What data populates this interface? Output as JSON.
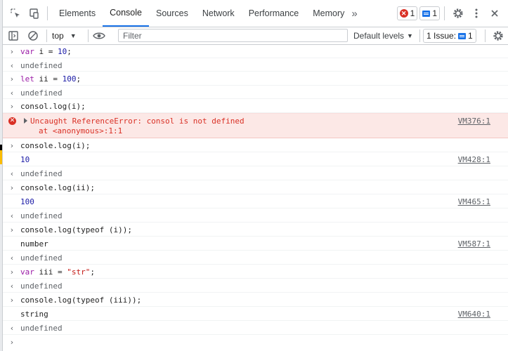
{
  "tabs": [
    {
      "label": "Elements"
    },
    {
      "label": "Console"
    },
    {
      "label": "Sources"
    },
    {
      "label": "Network"
    },
    {
      "label": "Performance"
    },
    {
      "label": "Memory"
    }
  ],
  "badges": {
    "errors": "1",
    "messages": "1"
  },
  "toolbar": {
    "context": "top",
    "filter_placeholder": "Filter",
    "levels": "Default levels",
    "issues": "1 Issue:",
    "issues_count": "1"
  },
  "console": {
    "r1": "var i = 10;",
    "undefined": "undefined",
    "r3": "let ii = 100;",
    "r5": "consol.log(i);",
    "err1": "Uncaught ReferenceError: consol is not defined",
    "err2": "at <anonymous>:1:1",
    "err_src": "VM376:1",
    "r7": "console.log(i);",
    "o8": "10",
    "s8": "VM428:1",
    "r10": "console.log(ii);",
    "o11": "100",
    "s11": "VM465:1",
    "r13": "console.log(typeof (i));",
    "o14": "number",
    "s14": "VM587:1",
    "r16": "var iii = \"str\";",
    "r18": "console.log(typeof (iii));",
    "o19": "string",
    "s19": "VM640:1"
  },
  "icons": {
    "input_prompt": "›",
    "output_arrow": "‹"
  }
}
